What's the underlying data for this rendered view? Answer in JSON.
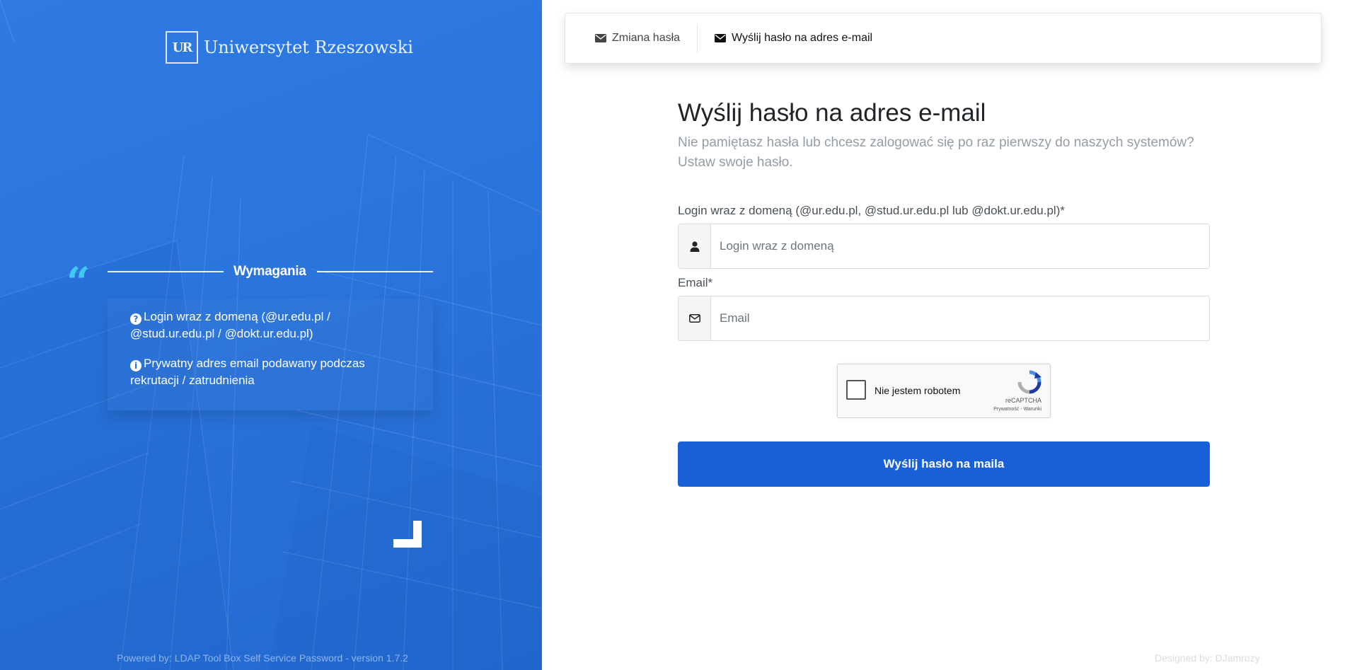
{
  "brand": {
    "logo_text": "Uniwersytet Rzeszowski",
    "logo_mark": "UR"
  },
  "requirements": {
    "title": "Wymagania",
    "items": [
      {
        "icon": "question-circle-icon",
        "glyph": "?",
        "text": "Login wraz z domeną (@ur.edu.pl / @stud.ur.edu.pl / @dokt.ur.edu.pl)"
      },
      {
        "icon": "info-circle-icon",
        "glyph": "i",
        "text": "Prywatny adres email podawany podczas rekrutacji / zatrudnienia"
      }
    ]
  },
  "footer": {
    "powered_by": "Powered by: LDAP Tool Box Self Service Password - version 1.7.2",
    "designed_by": "Designed by: DJamrozy"
  },
  "nav": {
    "items": [
      {
        "label": "Zmiana hasła",
        "icon": "envelope-icon",
        "active": false
      },
      {
        "label": "Wyślij hasło na adres e-mail",
        "icon": "envelope-icon",
        "active": true
      }
    ]
  },
  "form": {
    "title": "Wyślij hasło na adres e-mail",
    "subtitle": "Nie pamiętasz hasła lub chcesz zalogować się po raz pierwszy do naszych systemów? Ustaw swoje hasło.",
    "login_label": "Login wraz z domeną (@ur.edu.pl, @stud.ur.edu.pl lub @dokt.ur.edu.pl)*",
    "login_placeholder": "Login wraz z domeną",
    "login_value": "",
    "email_label": "Email*",
    "email_placeholder": "Email",
    "email_value": "",
    "submit_label": "Wyślij hasło na maila"
  },
  "captcha": {
    "label": "Nie jestem robotem",
    "brand": "reCAPTCHA",
    "links": "Prywatność - Warunki",
    "checked": false
  },
  "colors": {
    "left_panel": "#2a74dc",
    "accent_button": "#1860d8",
    "quote_mark": "#40c8f0"
  }
}
